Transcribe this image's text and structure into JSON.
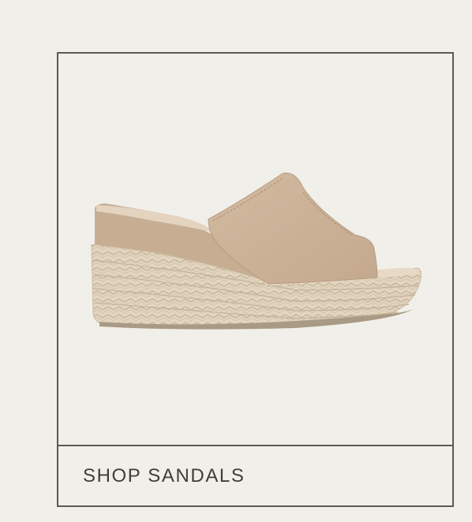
{
  "product": {
    "image_icon": "wedge-sandal-image",
    "colors": {
      "suede": "#cdb49a",
      "suede_shadow": "#b99d83",
      "insole": "#e6d6c4",
      "jute": "#e0d2bc",
      "jute_line": "#c8b69b",
      "sole": "#b0a18c"
    }
  },
  "cta": {
    "label": "SHOP SANDALS"
  },
  "theme": {
    "background": "#f1efe9",
    "border": "#5a5955",
    "text": "#3f3e3b"
  }
}
